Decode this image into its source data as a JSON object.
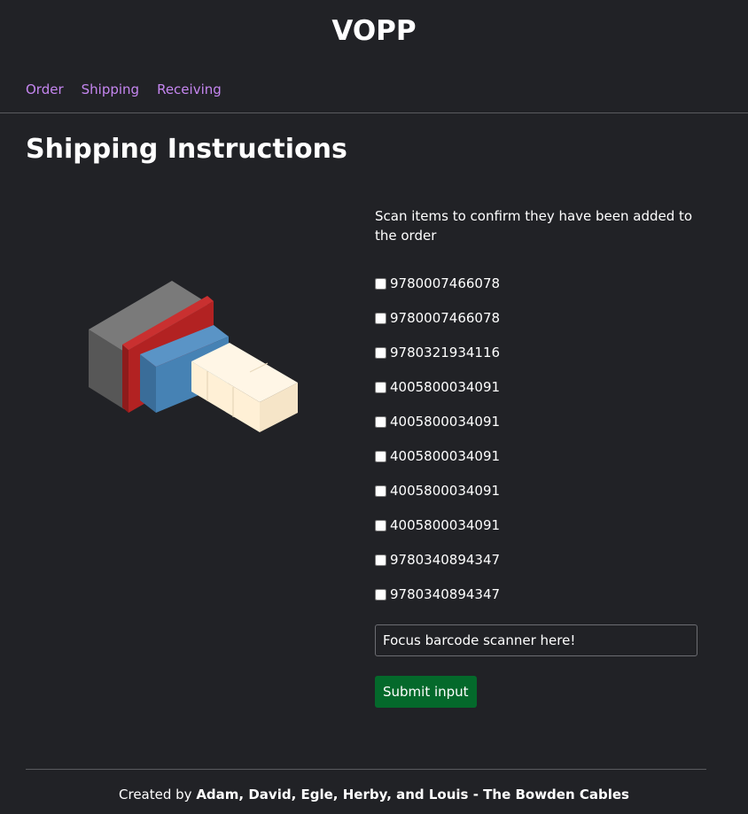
{
  "header": {
    "title": "VOPP"
  },
  "nav": {
    "items": [
      "Order",
      "Shipping",
      "Receiving"
    ]
  },
  "main": {
    "title": "Shipping Instructions",
    "instruction": "Scan items to confirm they have been added to the order",
    "items": [
      {
        "barcode": "9780007466078",
        "checked": false
      },
      {
        "barcode": "9780007466078",
        "checked": false
      },
      {
        "barcode": "9780321934116",
        "checked": false
      },
      {
        "barcode": "4005800034091",
        "checked": false
      },
      {
        "barcode": "4005800034091",
        "checked": false
      },
      {
        "barcode": "4005800034091",
        "checked": false
      },
      {
        "barcode": "4005800034091",
        "checked": false
      },
      {
        "barcode": "4005800034091",
        "checked": false
      },
      {
        "barcode": "9780340894347",
        "checked": false
      },
      {
        "barcode": "9780340894347",
        "checked": false
      }
    ],
    "scanner_placeholder": "Focus barcode scanner here!",
    "submit_label": "Submit input"
  },
  "footer": {
    "prefix": "Created by ",
    "credits": "Adam, David, Egle, Herby, and Louis - The Bowden Cables"
  },
  "colors": {
    "background": "#212226",
    "link": "#c586f0",
    "submit": "#04692b",
    "box_gray": "#6b6b6b",
    "box_red": "#b22222",
    "box_blue": "#4682b4",
    "box_cream": "#fff0d6"
  }
}
